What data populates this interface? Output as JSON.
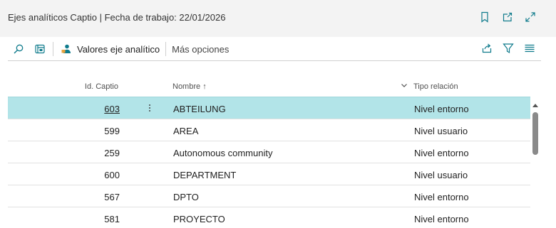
{
  "header": {
    "title": "Ejes analíticos Captio | Fecha de trabajo: 22/01/2026",
    "icons": [
      "bookmark-icon",
      "open-new-window-icon",
      "expand-icon"
    ]
  },
  "toolbar": {
    "search_icon": "search-icon",
    "edit_list_icon": "edit-list-icon",
    "valores_label": "Valores eje analítico",
    "mas_opciones_label": "Más opciones",
    "right_icons": [
      "share-icon",
      "filter-icon",
      "list-view-icon"
    ]
  },
  "table": {
    "columns": {
      "id": "Id. Captio",
      "nombre": "Nombre",
      "nombre_sort": "↑",
      "tipo": "Tipo relación"
    },
    "rows": [
      {
        "id": "603",
        "nombre": "ABTEILUNG",
        "tipo": "Nivel entorno"
      },
      {
        "id": "599",
        "nombre": "AREA",
        "tipo": "Nivel usuario"
      },
      {
        "id": "259",
        "nombre": "Autonomous community",
        "tipo": "Nivel entorno"
      },
      {
        "id": "600",
        "nombre": "DEPARTMENT",
        "tipo": "Nivel usuario"
      },
      {
        "id": "567",
        "nombre": "DPTO",
        "tipo": "Nivel entorno"
      },
      {
        "id": "581",
        "nombre": "PROYECTO",
        "tipo": "Nivel entorno"
      }
    ]
  },
  "colors": {
    "selected_row": "#b2e4e8",
    "accent": "#0f7b8c",
    "header_bg": "#f3f3f3"
  }
}
